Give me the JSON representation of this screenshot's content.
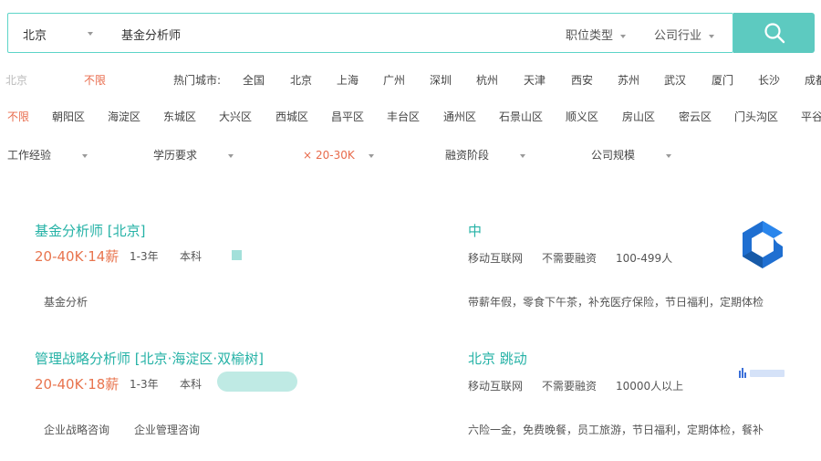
{
  "search": {
    "city": "北京",
    "query": "基金分析师",
    "filters": [
      "职位类型",
      "公司行业"
    ]
  },
  "city_row": {
    "label": "北京",
    "unlimited": "不限",
    "hot_label": "热门城市:",
    "cities": [
      "全国",
      "北京",
      "上海",
      "广州",
      "深圳",
      "杭州",
      "天津",
      "西安",
      "苏州",
      "武汉",
      "厦门",
      "长沙",
      "成都"
    ]
  },
  "district_row": {
    "items": [
      "不限",
      "朝阳区",
      "海淀区",
      "东城区",
      "大兴区",
      "西城区",
      "昌平区",
      "丰台区",
      "通州区",
      "石景山区",
      "顺义区",
      "房山区",
      "密云区",
      "门头沟区",
      "平谷"
    ]
  },
  "other_row": {
    "items": [
      "工作经验",
      "学历要求",
      "20-30K",
      "融资阶段",
      "公司规模"
    ],
    "active_prefix": "×"
  },
  "jobs": [
    {
      "title": "基金分析师  [北京]",
      "salary": "20-40K·14薪",
      "experience": "1-3年",
      "education": "本科",
      "skills": [
        "基金分析"
      ],
      "company": "中",
      "company_meta": [
        "移动互联网",
        "不需要融资",
        "100-499人"
      ],
      "perks": "带薪年假，零食下午茶，补充医疗保险，节日福利，定期体检"
    },
    {
      "title": "管理战略分析师  [北京·海淀区·双榆树]",
      "salary": "20-40K·18薪",
      "experience": "1-3年",
      "education": "本科",
      "skills": [
        "企业战略咨询",
        "企业管理咨询"
      ],
      "company": "北京   跳动",
      "company_meta": [
        "移动互联网",
        "不需要融资",
        "10000人以上"
      ],
      "perks": "六险一金，免费晚餐，员工旅游，节日福利，定期体检，餐补"
    }
  ],
  "colors": {
    "accent": "#5dcac0",
    "link": "#25b2a6",
    "salary": "#e8744e",
    "active": "#e86b4c"
  },
  "icons": {
    "search_button": "search-icon",
    "company_logo_1": "company-logo-icon",
    "company_logo_2": "company-logo-icon"
  }
}
